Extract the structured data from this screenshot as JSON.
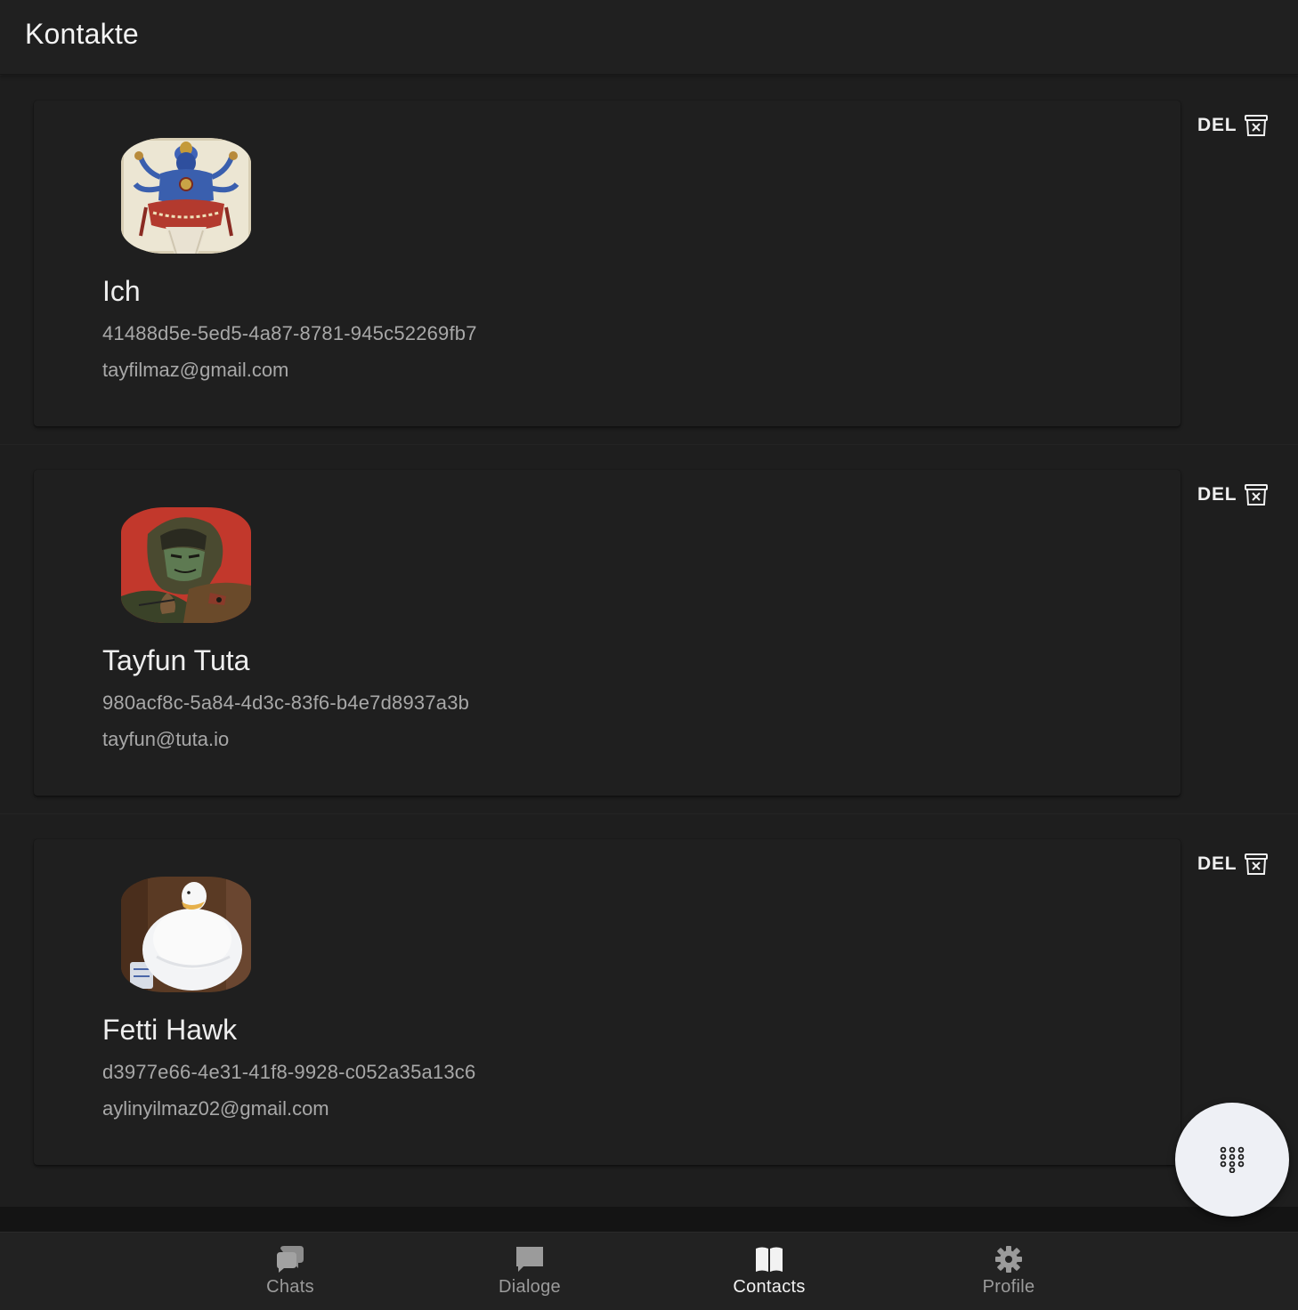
{
  "header": {
    "title": "Kontakte"
  },
  "contacts": [
    {
      "name": "Ich",
      "id": "41488d5e-5ed5-4a87-8781-945c52269fb7",
      "email": "tayfilmaz@gmail.com",
      "avatar": "avatar-deity"
    },
    {
      "name": "Tayfun Tuta",
      "id": "980acf8c-5a84-4d3c-83f6-b4e7d8937a3b",
      "email": "tayfun@tuta.io",
      "avatar": "avatar-soldier"
    },
    {
      "name": "Fetti Hawk",
      "id": "d3977e66-4e31-41f8-9928-c052a35a13c6",
      "email": "aylinyilmaz02@gmail.com",
      "avatar": "avatar-duck"
    }
  ],
  "actions": {
    "delete_label": "DEL",
    "delete_icon": "delete-box-icon"
  },
  "fab": {
    "icon": "dialpad-icon"
  },
  "nav": {
    "items": [
      {
        "label": "Chats",
        "icon": "chats-icon"
      },
      {
        "label": "Dialoge",
        "icon": "message-icon"
      },
      {
        "label": "Contacts",
        "icon": "book-icon",
        "active": true
      },
      {
        "label": "Profile",
        "icon": "gear-icon"
      }
    ]
  },
  "colors": {
    "background": "#1e1e1e",
    "card": "#1f1f1f",
    "nav": "#222222",
    "fab": "#eef0f5"
  }
}
